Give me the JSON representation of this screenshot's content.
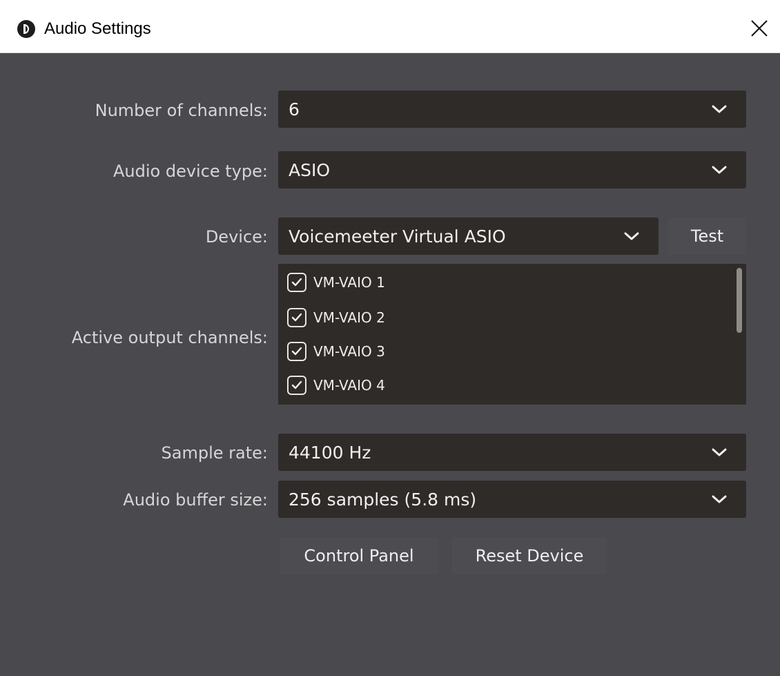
{
  "window": {
    "title": "Audio Settings",
    "app_icon": "app-logo-icon",
    "close_icon": "close-icon"
  },
  "fields": {
    "channels": {
      "label": "Number of channels:",
      "value": "6"
    },
    "device_type": {
      "label": "Audio device type:",
      "value": "ASIO"
    },
    "device": {
      "label": "Device:",
      "value": "Voicemeeter Virtual ASIO",
      "test_label": "Test"
    },
    "active_outputs": {
      "label": "Active output channels:",
      "channels": [
        {
          "name": "VM-VAIO 1",
          "checked": true
        },
        {
          "name": "VM-VAIO 2",
          "checked": true
        },
        {
          "name": "VM-VAIO 3",
          "checked": true
        },
        {
          "name": "VM-VAIO 4",
          "checked": true
        }
      ]
    },
    "sample_rate": {
      "label": "Sample rate:",
      "value": "44100 Hz"
    },
    "buffer_size": {
      "label": "Audio buffer size:",
      "value": "256 samples (5.8 ms)"
    }
  },
  "buttons": {
    "control_panel": "Control Panel",
    "reset_device": "Reset Device"
  },
  "colors": {
    "background": "#4a494e",
    "field": "#2f2b29",
    "text": "#d6d6d6",
    "value_text": "#f0f0f0"
  }
}
